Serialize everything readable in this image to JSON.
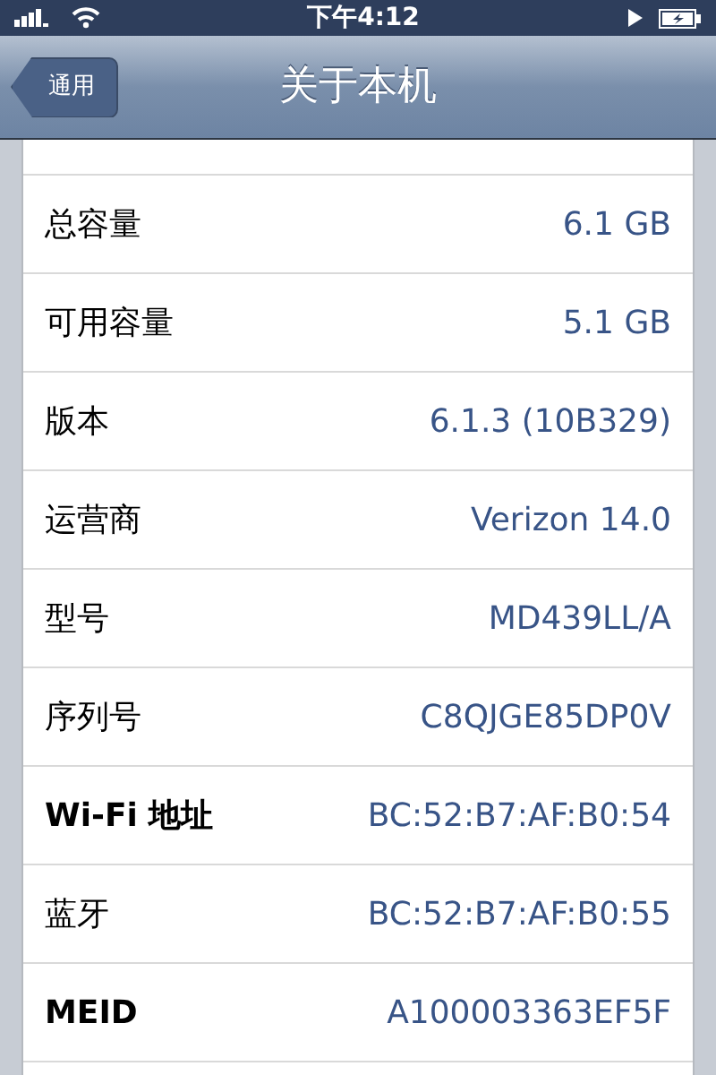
{
  "status_bar": {
    "time": "下午4:12"
  },
  "nav_bar": {
    "back_button": "通用",
    "title": "关于本机"
  },
  "rows": [
    {
      "label": "总容量",
      "value": "6.1 GB",
      "label_bold": false
    },
    {
      "label": "可用容量",
      "value": "5.1 GB",
      "label_bold": false
    },
    {
      "label": "版本",
      "value": "6.1.3 (10B329)",
      "label_bold": false
    },
    {
      "label": "运营商",
      "value": "Verizon 14.0",
      "label_bold": false
    },
    {
      "label": "型号",
      "value": "MD439LL/A",
      "label_bold": false
    },
    {
      "label": "序列号",
      "value": "C8QJGE85DP0V",
      "label_bold": false
    },
    {
      "label": "Wi-Fi 地址",
      "value": "BC:52:B7:AF:B0:54",
      "label_bold": true
    },
    {
      "label": "蓝牙",
      "value": "BC:52:B7:AF:B0:55",
      "label_bold": false
    },
    {
      "label": "MEID",
      "value": "A100003363EF5F",
      "label_bold": true
    }
  ]
}
